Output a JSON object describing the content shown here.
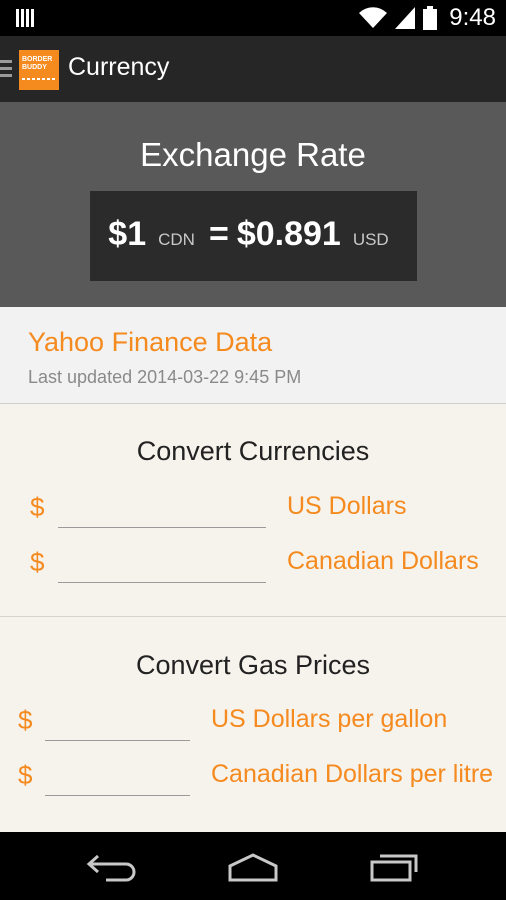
{
  "status_bar": {
    "time": "9:48",
    "icons": [
      "notification-icon",
      "wifi-icon",
      "signal-icon",
      "battery-icon"
    ]
  },
  "action_bar": {
    "title": "Currency",
    "logo_text": "BORDER BUDDY"
  },
  "exchange_rate": {
    "heading": "Exchange Rate",
    "from_amount": "$1",
    "from_unit": "CDN",
    "equals": "=",
    "to_amount": "$0.891",
    "to_unit": "USD"
  },
  "source": {
    "name": "Yahoo Finance Data",
    "last_updated": "Last updated 2014-03-22 9:45 PM"
  },
  "convert_currencies": {
    "heading": "Convert Currencies",
    "rows": [
      {
        "symbol": "$",
        "value": "",
        "label": "US Dollars"
      },
      {
        "symbol": "$",
        "value": "",
        "label": "Canadian Dollars"
      }
    ]
  },
  "convert_gas": {
    "heading": "Convert Gas Prices",
    "rows": [
      {
        "symbol": "$",
        "value": "",
        "label": "US Dollars per gallon"
      },
      {
        "symbol": "$",
        "value": "",
        "label": "Canadian Dollars per litre"
      }
    ]
  },
  "colors": {
    "accent": "#f58a1f",
    "action_bar": "#262626",
    "rate_panel": "#595959",
    "rate_box": "#2b2b2b",
    "section_bg": "#f6f2ec"
  }
}
